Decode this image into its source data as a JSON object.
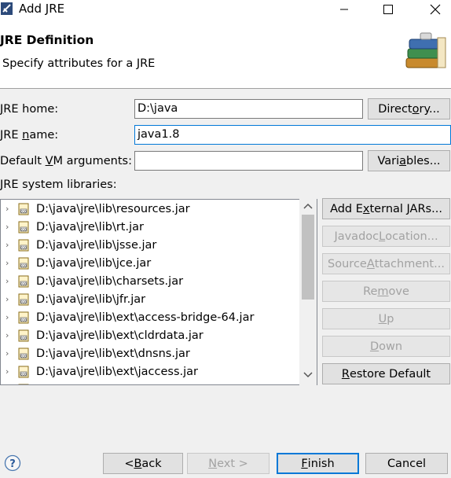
{
  "window": {
    "title": "Add JRE"
  },
  "header": {
    "title": "JRE Definition",
    "subtitle": "Specify attributes for a JRE"
  },
  "form": {
    "jre_home": {
      "label_prefix": "",
      "label_mn": "J",
      "label_rest": "RE home:",
      "value": "D:\\java"
    },
    "jre_name": {
      "label_prefix": "JRE ",
      "label_mn": "n",
      "label_rest": "ame:",
      "value": "java1.8"
    },
    "vm_args": {
      "label_prefix": "Default ",
      "label_mn": "V",
      "label_rest": "M arguments:",
      "value": ""
    },
    "libs_label": "JRE system libraries:"
  },
  "buttons": {
    "directory": {
      "pre": "Direct",
      "mn": "o",
      "post": "ry..."
    },
    "variables": {
      "pre": "Vari",
      "mn": "a",
      "post": "bles..."
    },
    "add_external_jars": {
      "pre": "Add E",
      "mn": "x",
      "post": "ternal JARs..."
    },
    "javadoc_location": {
      "pre": "Javadoc ",
      "mn": "L",
      "post": "ocation..."
    },
    "source_attachment": {
      "pre": "Source ",
      "mn": "A",
      "post": "ttachment..."
    },
    "remove": {
      "pre": "Re",
      "mn": "m",
      "post": "ove"
    },
    "up": {
      "pre": "",
      "mn": "U",
      "post": "p"
    },
    "down": {
      "pre": "",
      "mn": "D",
      "post": "own"
    },
    "restore_default": {
      "pre": "",
      "mn": "R",
      "post": "estore Default"
    },
    "back": {
      "pre": "< ",
      "mn": "B",
      "post": "ack"
    },
    "next": {
      "pre": "",
      "mn": "N",
      "post": "ext >"
    },
    "finish": {
      "pre": "",
      "mn": "F",
      "post": "inish"
    },
    "cancel": {
      "pre": "Cancel",
      "mn": "",
      "post": ""
    }
  },
  "libraries": [
    "D:\\java\\jre\\lib\\resources.jar",
    "D:\\java\\jre\\lib\\rt.jar",
    "D:\\java\\jre\\lib\\jsse.jar",
    "D:\\java\\jre\\lib\\jce.jar",
    "D:\\java\\jre\\lib\\charsets.jar",
    "D:\\java\\jre\\lib\\jfr.jar",
    "D:\\java\\jre\\lib\\ext\\access-bridge-64.jar",
    "D:\\java\\jre\\lib\\ext\\cldrdata.jar",
    "D:\\java\\jre\\lib\\ext\\dnsns.jar",
    "D:\\java\\jre\\lib\\ext\\jaccess.jar"
  ],
  "icons": {
    "app": "eclipse-app-icon",
    "minimize": "minimize-icon",
    "maximize": "maximize-icon",
    "close": "close-icon",
    "header": "books-icon",
    "library": "jar-library-icon",
    "expand": "chevron-right-icon",
    "help": "help-icon"
  },
  "colors": {
    "accent": "#0078d7",
    "disabled_text": "#a2a2a2"
  }
}
